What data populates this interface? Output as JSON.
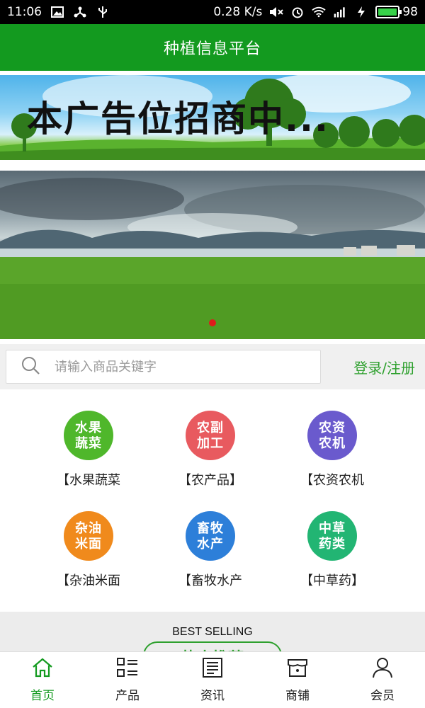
{
  "status": {
    "time": "11:06",
    "speed": "0.28 K/s",
    "network": "4G",
    "battery": "98",
    "battery_level": 0.98
  },
  "header": {
    "title": "种植信息平台"
  },
  "ad": {
    "text": "本广告位招商中..."
  },
  "search": {
    "placeholder": "请输入商品关键字",
    "login": "登录/注册"
  },
  "categories": [
    {
      "icon": "水果\n蔬菜",
      "label": "【水果蔬菜",
      "color": "#4fb72b"
    },
    {
      "icon": "农副\n加工",
      "label": "【农产品】",
      "color": "#e85a5f"
    },
    {
      "icon": "农资\n农机",
      "label": "【农资农机",
      "color": "#6a5acd"
    },
    {
      "icon": "杂油\n米面",
      "label": "【杂油米面",
      "color": "#f08a1c"
    },
    {
      "icon": "畜牧\n水产",
      "label": "【畜牧水产",
      "color": "#2d7fd9"
    },
    {
      "icon": "中草\n药类",
      "label": "【中草药】",
      "color": "#22b573"
    }
  ],
  "best": {
    "title": "BEST SELLING",
    "pill": "热卖推荐"
  },
  "nav": [
    {
      "label": "首页",
      "icon": "home-icon"
    },
    {
      "label": "产品",
      "icon": "list-icon"
    },
    {
      "label": "资讯",
      "icon": "news-icon"
    },
    {
      "label": "商铺",
      "icon": "shop-icon"
    },
    {
      "label": "会员",
      "icon": "user-icon"
    }
  ],
  "colors": {
    "brand": "#139a1f",
    "accent": "#2ea02e",
    "indicator": "#e01b1b"
  }
}
